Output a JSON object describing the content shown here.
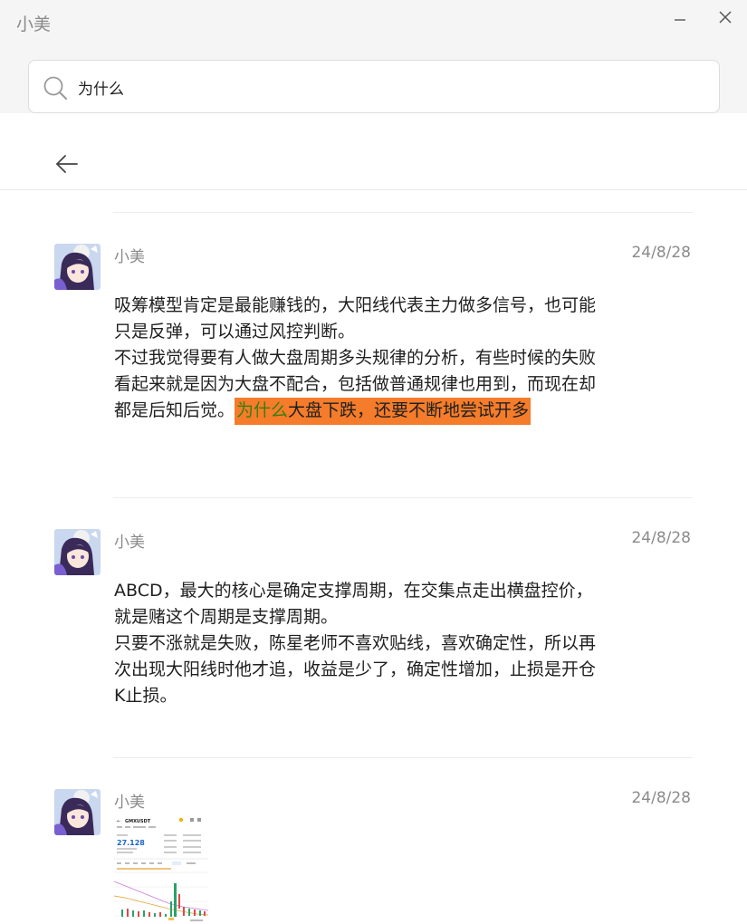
{
  "window": {
    "title": "小美",
    "minimize_icon": "minimize-icon",
    "close_icon": "close-icon"
  },
  "search": {
    "value": "为什么",
    "placeholder": "",
    "icon": "search-icon"
  },
  "nav": {
    "back_icon": "arrow-left-icon"
  },
  "highlight_color": "#f57c2a",
  "keyword_color": "#3a7d0f",
  "messages": [
    {
      "sender": "小美",
      "date": "24/8/28",
      "text_before": "吸筹模型肯定是最能赚钱的，大阳线代表主力做多信号，也可能只是反弹，可以通过风控判断。\n不过我觉得要有人做大盘周期多头规律的分析，有些时候的失败看起来就是因为大盘不配合，包括做普通规律也用到，而现在却都是后知后觉。",
      "highlight_keyword": "为什么",
      "highlight_rest": "大盘下跌，还要不断地尝试开多"
    },
    {
      "sender": "小美",
      "date": "24/8/28",
      "text": "ABCD，最大的核心是确定支撑周期，在交集点走出横盘控价，就是赌这个周期是支撑周期。\n只要不涨就是失败，陈星老师不喜欢贴线，喜欢确定性，所以再次出现大阳线时他才追，收益是少了，确定性增加，止损是开仓K止损。"
    },
    {
      "sender": "小美",
      "date": "24/8/28",
      "image": {
        "symbol": "GMXUSDT",
        "price": "27.128"
      }
    }
  ]
}
